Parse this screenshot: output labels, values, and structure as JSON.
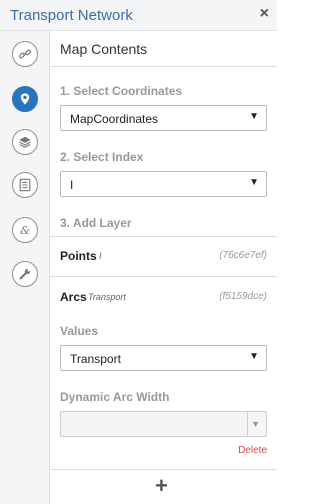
{
  "header": {
    "title": "Transport Network",
    "close_glyph": "×"
  },
  "sidebar": {
    "items": [
      {
        "name": "link-icon",
        "active": false
      },
      {
        "name": "map-marker-icon",
        "active": true
      },
      {
        "name": "layers-icon",
        "active": false
      },
      {
        "name": "list-icon",
        "active": false
      },
      {
        "name": "ampersand-icon",
        "active": false
      },
      {
        "name": "wrench-icon",
        "active": false
      }
    ]
  },
  "panel": {
    "title": "Map Contents",
    "step1": {
      "label": "1. Select Coordinates",
      "value": "MapCoordinates"
    },
    "step2": {
      "label": "2. Select Index",
      "value": "I"
    },
    "step3": {
      "label": "3. Add Layer"
    },
    "layers": [
      {
        "name": "Points",
        "subtitle": "I",
        "id": "(76c6e7ef)"
      },
      {
        "name": "Arcs",
        "subtitle": "Transport",
        "id": "(f5159dce)"
      }
    ],
    "values": {
      "label": "Values",
      "value": "Transport"
    },
    "dynamic_arc_width": {
      "label": "Dynamic Arc Width",
      "value": ""
    },
    "delete_label": "Delete",
    "add_glyph": "+"
  }
}
